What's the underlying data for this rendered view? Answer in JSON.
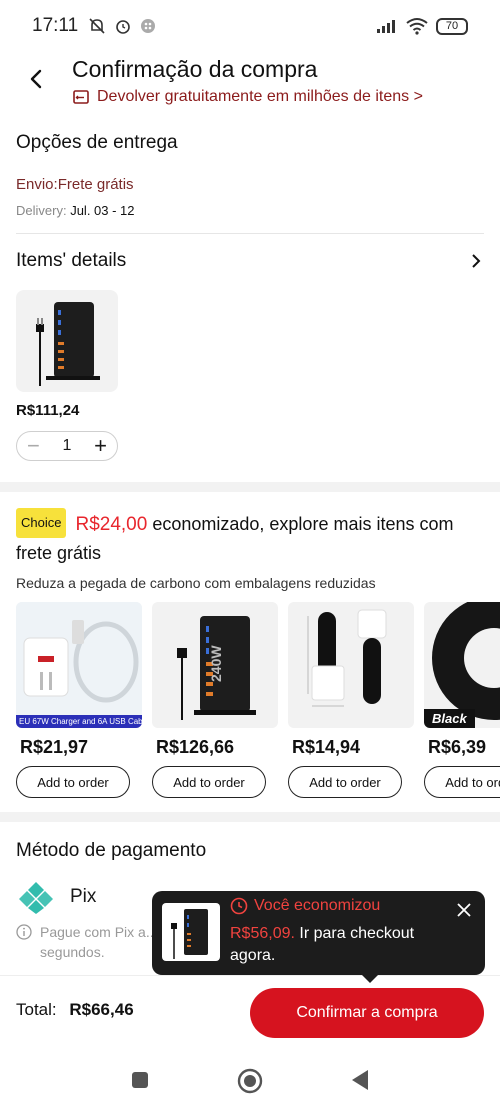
{
  "status_bar": {
    "time": "17:11",
    "battery": "70"
  },
  "header": {
    "title": "Confirmação da compra",
    "return_link": "Devolver gratuitamente em milhões de itens >"
  },
  "delivery": {
    "title": "Opções de entrega",
    "shipping": "Envio:Frete grátis",
    "date_label": "Delivery:",
    "date_value": "Jul. 03 - 12"
  },
  "items": {
    "title": "Items' details",
    "price": "R$111,24",
    "quantity": "1"
  },
  "choice": {
    "badge": "Choice",
    "saved": "R$24,00",
    "line": "economizado, explore mais itens com frete grátis",
    "subtitle": "Reduza a pegada de carbono com embalagens reduzidas",
    "products": [
      {
        "price": "R$21,97",
        "button": "Add to order",
        "caption": "EU 67W Charger and 6A USB Cable"
      },
      {
        "price": "R$126,66",
        "button": "Add to order",
        "caption": "240W"
      },
      {
        "price": "R$14,94",
        "button": "Add to order"
      },
      {
        "price": "R$6,39",
        "button": "Add to order",
        "caption": "Black"
      }
    ]
  },
  "payment": {
    "title": "Método de pagamento",
    "method": "Pix",
    "note": "Pague com Pix a... simples, práticos... em segundos."
  },
  "toast": {
    "title": "Você economizou",
    "amount": "R$56,09.",
    "message": "Ir para checkout agora."
  },
  "bottom": {
    "total_label": "Total:",
    "total_value": "R$66,46",
    "confirm": "Confirmar a compra"
  },
  "colors": {
    "accent_red": "#d6131f",
    "choice_yellow": "#f7e13b",
    "pix_teal": "#32bcad"
  }
}
